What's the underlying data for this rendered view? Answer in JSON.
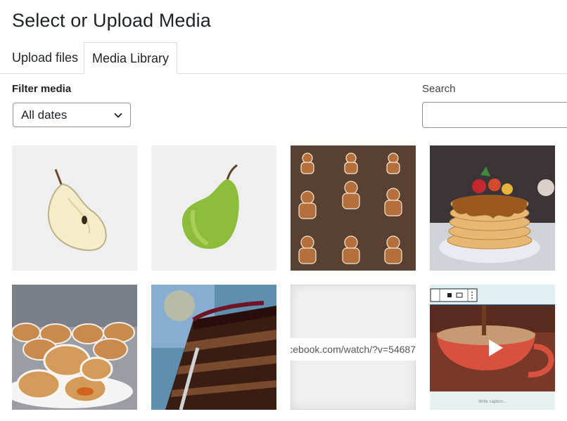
{
  "header": {
    "title": "Select or Upload Media"
  },
  "tabs": [
    {
      "label": "Upload files",
      "active": false
    },
    {
      "label": "Media Library",
      "active": true
    }
  ],
  "filter": {
    "label": "Filter media",
    "selected": "All dates"
  },
  "search": {
    "label": "Search",
    "value": ""
  },
  "grid": {
    "items": [
      {
        "name": "halved-pear"
      },
      {
        "name": "green-pear"
      },
      {
        "name": "gingerbread-cookies"
      },
      {
        "name": "pancake-stack"
      },
      {
        "name": "sugared-donuts"
      },
      {
        "name": "chocolate-cake-slice"
      },
      {
        "name": "facebook-embed",
        "url_text": "acebook.com/watch/?v=54687"
      },
      {
        "name": "video-cocoa-mug",
        "caption": "Write caption..."
      }
    ]
  },
  "colors": {
    "accent": "#2271b1",
    "border": "#dcdcde",
    "text": "#1d2327"
  }
}
